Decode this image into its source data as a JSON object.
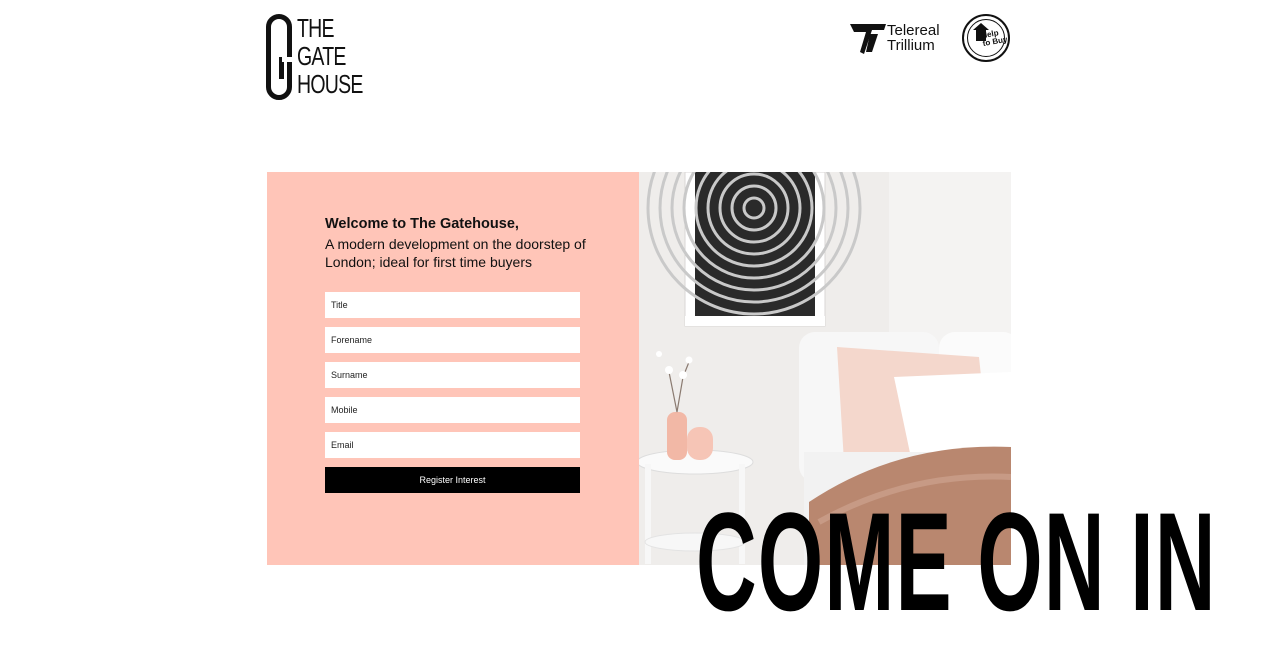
{
  "brand": {
    "lines": [
      "THE",
      "GATE",
      "HOUSE"
    ]
  },
  "partners": {
    "telereal_line1": "Telereal",
    "telereal_line2": "Trillium",
    "help_to_buy_line1": "Help",
    "help_to_buy_line2": "to Buy"
  },
  "hero": {
    "welcome_title": "Welcome to The Gatehouse,",
    "welcome_sub": "A modern development on the doorstep of London; ideal for first time buyers",
    "headline": "COME ON IN"
  },
  "form": {
    "title_placeholder": "Title",
    "forename_placeholder": "Forename",
    "surname_placeholder": "Surname",
    "mobile_placeholder": "Mobile",
    "email_placeholder": "Email",
    "submit_label": "Register Interest"
  },
  "colors": {
    "panel_pink": "#ffc5b8",
    "button_black": "#000000",
    "background": "#ffffff"
  },
  "icons": {
    "telereal_mark": "telereal-logo-icon",
    "help_to_buy": "help-to-buy-logo-icon",
    "brand_mark": "gatehouse-g-logo-icon"
  }
}
